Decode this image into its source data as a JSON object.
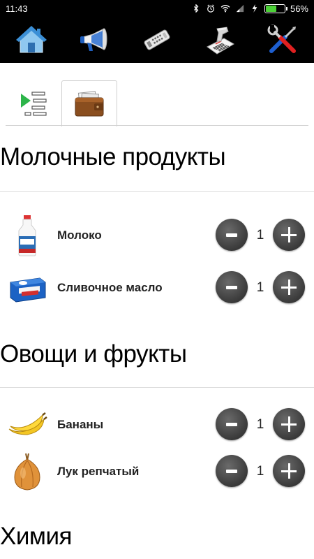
{
  "status_bar": {
    "time": "11:43",
    "battery_percent_label": "56%",
    "battery_level": 0.56,
    "icons": [
      "bluetooth-icon",
      "alarm-icon",
      "wifi-icon",
      "signal-icon",
      "charging-icon",
      "battery-icon"
    ]
  },
  "toolbar": {
    "icons": [
      "home-icon",
      "megaphone-icon",
      "remote-control-icon",
      "barcode-scanner-icon",
      "tools-settings-icon"
    ]
  },
  "tabs": {
    "icons": [
      "list-play-icon",
      "wallet-icon"
    ],
    "active_index": 1
  },
  "sections": [
    {
      "title": "Молочные продукты",
      "items": [
        {
          "name": "Молоко",
          "quantity": "1",
          "icon": "milk-bottle-icon"
        },
        {
          "name": "Сливочное масло",
          "quantity": "1",
          "icon": "butter-pack-icon"
        }
      ]
    },
    {
      "title": "Овощи и фрукты",
      "items": [
        {
          "name": "Бананы",
          "quantity": "1",
          "icon": "bananas-icon"
        },
        {
          "name": "Лук репчатый",
          "quantity": "1",
          "icon": "onion-icon"
        }
      ]
    },
    {
      "title": "Химия",
      "items": []
    }
  ],
  "colors": {
    "bar_background": "#000000",
    "stepper_button": "#3a3a3a",
    "battery_fill": "#4cd137",
    "divider": "#dcdcdc"
  }
}
